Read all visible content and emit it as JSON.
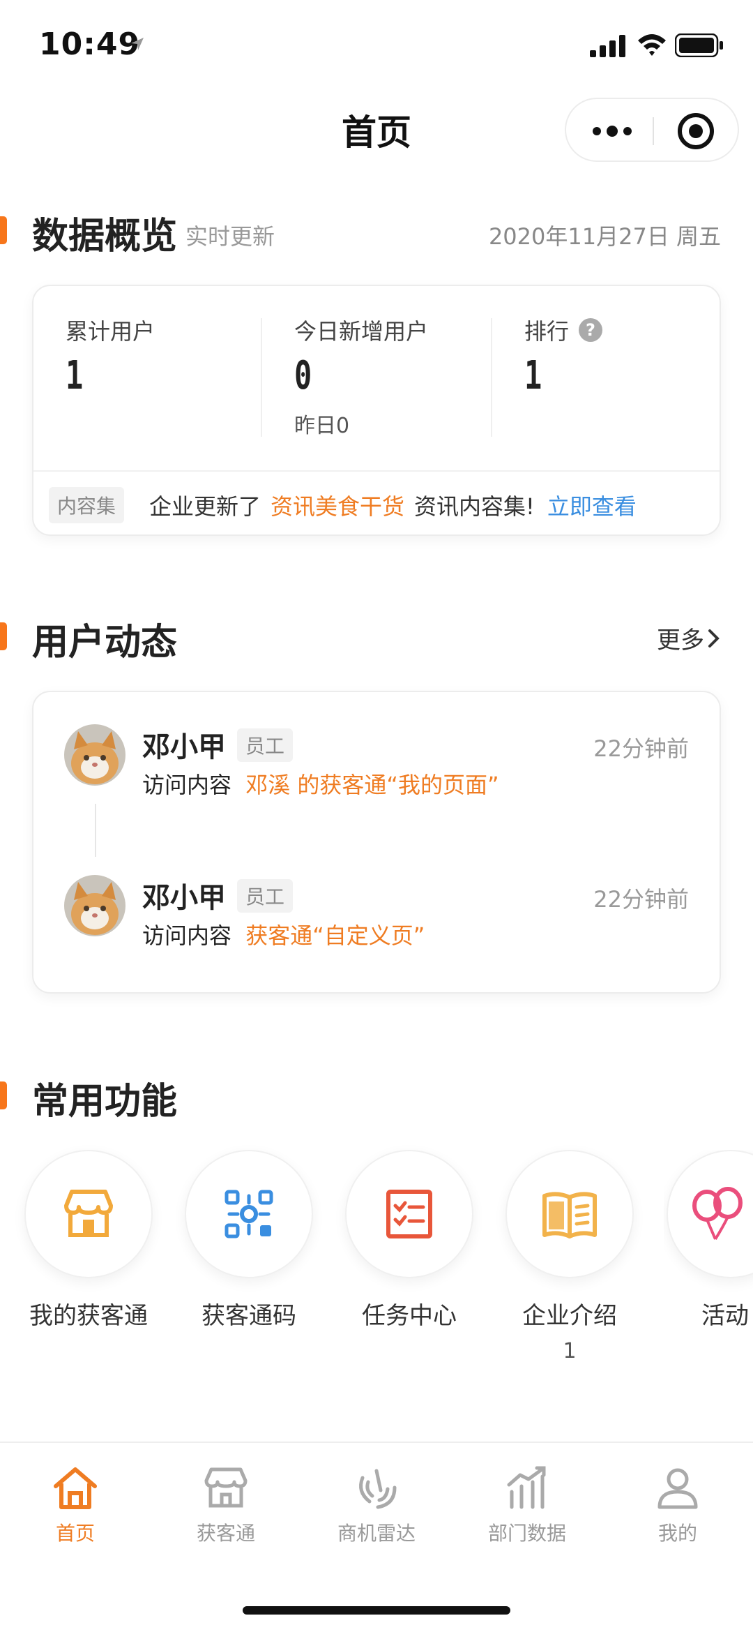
{
  "status_bar": {
    "time": "10:49"
  },
  "nav": {
    "title": "首页"
  },
  "overview": {
    "title": "数据概览",
    "subtitle": "实时更新",
    "date": "2020年11月27日 周五",
    "stats": [
      {
        "label": "累计用户",
        "value": "1"
      },
      {
        "label": "今日新增用户",
        "value": "0",
        "sub": "昨日0"
      },
      {
        "label": "排行",
        "value": "1"
      }
    ],
    "notice": {
      "tag": "内容集",
      "text_before": "企业更新了",
      "highlight": "资讯美食干货",
      "text_after": "资讯内容集!",
      "link": "立即查看"
    }
  },
  "activity": {
    "title": "用户动态",
    "more": "更多",
    "items": [
      {
        "name": "邓小甲",
        "role": "员工",
        "time": "22分钟前",
        "action": "访问内容",
        "target": "邓溪 的获客通“我的页面”"
      },
      {
        "name": "邓小甲",
        "role": "员工",
        "time": "22分钟前",
        "action": "访问内容",
        "target": "获客通“自定义页”"
      }
    ]
  },
  "functions": {
    "title": "常用功能",
    "items": [
      {
        "label": "我的获客通",
        "icon": "store-icon",
        "color": "#f2a93b"
      },
      {
        "label": "获客通码",
        "icon": "qr-code-icon",
        "color": "#3a8ee0"
      },
      {
        "label": "任务中心",
        "icon": "task-list-icon",
        "color": "#e8563a"
      },
      {
        "label": "企业介绍",
        "icon": "book-icon",
        "color": "#f2b24a",
        "badge": "1"
      },
      {
        "label": "活动",
        "icon": "balloon-icon",
        "color": "#ea4e7c"
      }
    ]
  },
  "tabbar": {
    "items": [
      {
        "label": "首页",
        "icon": "home-icon",
        "active": true
      },
      {
        "label": "获客通",
        "icon": "store-icon"
      },
      {
        "label": "商机雷达",
        "icon": "radar-icon"
      },
      {
        "label": "部门数据",
        "icon": "chart-icon"
      },
      {
        "label": "我的",
        "icon": "user-icon"
      }
    ]
  },
  "colors": {
    "accent": "#ef7c22",
    "link": "#3a8ee0"
  }
}
